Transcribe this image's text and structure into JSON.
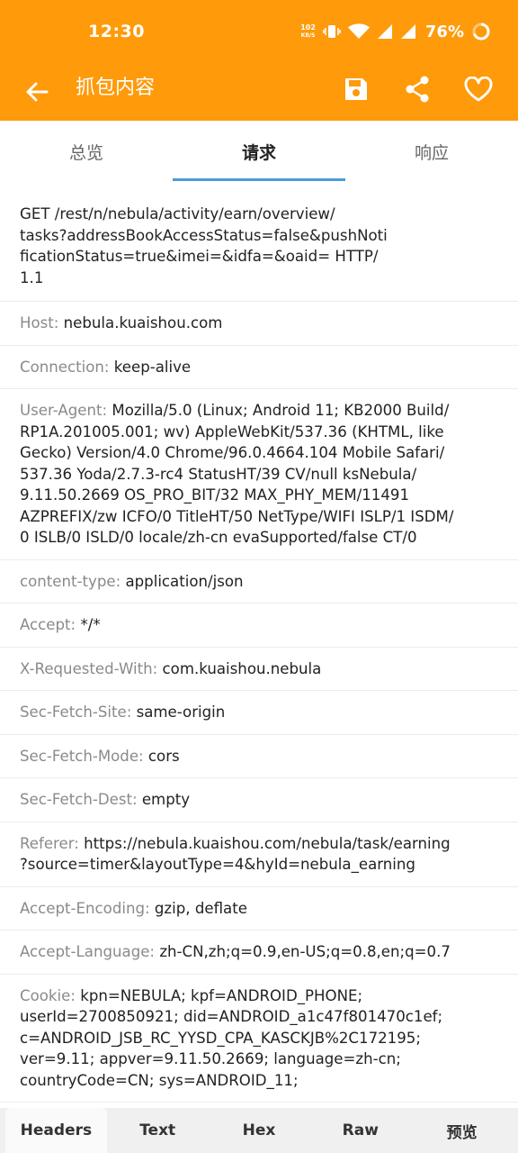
{
  "status_bar": {
    "time": "12:30",
    "net_speed_value": "102",
    "net_speed_unit": "KB/S",
    "battery": "76%"
  },
  "app_bar": {
    "title": "抓包内容",
    "icons": [
      "back-arrow-icon",
      "save-icon",
      "share-icon",
      "heart-icon"
    ]
  },
  "tabs": [
    {
      "label": "总览",
      "active": false
    },
    {
      "label": "请求",
      "active": true
    },
    {
      "label": "响应",
      "active": false
    }
  ],
  "request": {
    "line": "GET /rest/n/nebula/activity/earn/overview/\ntasks?addressBookAccessStatus=false&pushNoti\nficationStatus=true&imei=&idfa=&oaid= HTTP/\n1.1",
    "headers": [
      {
        "name": "Host:",
        "value": "nebula.kuaishou.com"
      },
      {
        "name": "Connection:",
        "value": "keep-alive"
      },
      {
        "name": "User-Agent:",
        "value": "Mozilla/5.0 (Linux; Android 11; KB2000 Build/\nRP1A.201005.001; wv) AppleWebKit/537.36 (KHTML, like\nGecko) Version/4.0 Chrome/96.0.4664.104 Mobile Safari/\n537.36 Yoda/2.7.3-rc4 StatusHT/39 CV/null ksNebula/\n9.11.50.2669 OS_PRO_BIT/32 MAX_PHY_MEM/11491\nAZPREFIX/zw ICFO/0 TitleHT/50 NetType/WIFI ISLP/1 ISDM/\n0 ISLB/0 ISLD/0 locale/zh-cn evaSupported/false CT/0"
      },
      {
        "name": "content-type:",
        "value": "application/json"
      },
      {
        "name": "Accept:",
        "value": "*/*"
      },
      {
        "name": "X-Requested-With:",
        "value": "com.kuaishou.nebula"
      },
      {
        "name": "Sec-Fetch-Site:",
        "value": "same-origin"
      },
      {
        "name": "Sec-Fetch-Mode:",
        "value": "cors"
      },
      {
        "name": "Sec-Fetch-Dest:",
        "value": "empty"
      },
      {
        "name": "Referer:",
        "value": "https://nebula.kuaishou.com/nebula/task/earning\n?source=timer&layoutType=4&hyId=nebula_earning"
      },
      {
        "name": "Accept-Encoding:",
        "value": "gzip, deflate"
      },
      {
        "name": "Accept-Language:",
        "value": "zh-CN,zh;q=0.9,en-US;q=0.8,en;q=0.7"
      },
      {
        "name": "Cookie:",
        "value": "kpn=NEBULA; kpf=ANDROID_PHONE;\nuserId=2700850921; did=ANDROID_a1c47f801470c1ef;\nc=ANDROID_JSB_RC_YYSD_CPA_KASCKJB%2C172195;\nver=9.11; appver=9.11.50.2669; language=zh-cn;\ncountryCode=CN; sys=ANDROID_11;"
      }
    ]
  },
  "bottom_tabs": [
    {
      "label": "Headers",
      "active": true
    },
    {
      "label": "Text",
      "active": false
    },
    {
      "label": "Hex",
      "active": false
    },
    {
      "label": "Raw",
      "active": false
    },
    {
      "label": "预览",
      "active": false
    }
  ],
  "colors": {
    "accent": "#FF9A0A",
    "tab_indicator": "#4D9BD5",
    "header_name": "#8a8a8a"
  }
}
